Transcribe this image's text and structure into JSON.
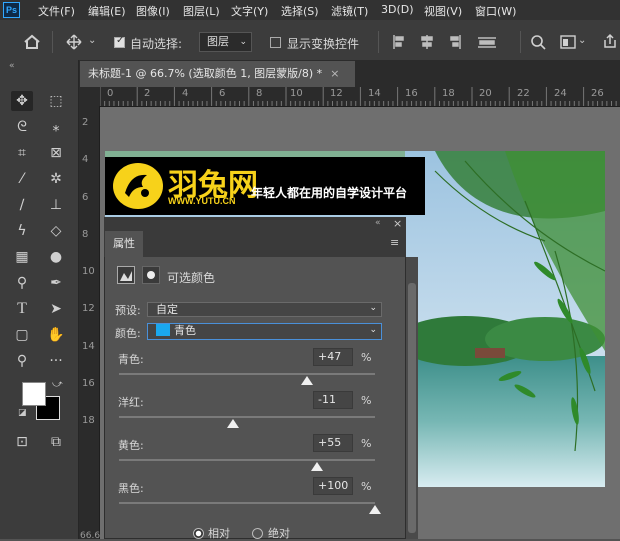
{
  "app": {
    "logo": "Ps"
  },
  "menu": [
    "文件(F)",
    "编辑(E)",
    "图像(I)",
    "图层(L)",
    "文字(Y)",
    "选择(S)",
    "滤镜(T)",
    "3D(D)",
    "视图(V)",
    "窗口(W)"
  ],
  "options": {
    "auto_select_label": "自动选择:",
    "auto_select_checked": true,
    "layer_target": "图层",
    "show_transform_label": "显示变换控件",
    "show_transform_checked": false
  },
  "document": {
    "tab_title": "未标题-1 @ 66.7% (选取颜色 1, 图层蒙版/8) *",
    "close_glyph": "×",
    "zoom_partial": "66.6"
  },
  "ruler": {
    "horizontal": [
      "0",
      "2",
      "4",
      "6",
      "8",
      "10",
      "12",
      "14",
      "16",
      "18",
      "20",
      "22",
      "24",
      "26"
    ],
    "vertical": [
      "2",
      "4",
      "6",
      "8",
      "10",
      "12",
      "14",
      "16",
      "18"
    ]
  },
  "banner": {
    "brand_cn": "羽兔网",
    "url": "WWW.YUTU.CN",
    "slogan": "年轻人都在用的自学设计平台",
    "brand_color": "#f7d21a"
  },
  "properties": {
    "panel_title": "属性",
    "adjustment_name": "可选颜色",
    "preset_label": "预设:",
    "preset_value": "自定",
    "colors_label": "颜色:",
    "colors_value": "青色",
    "colors_swatch": "#1aa8ef",
    "sliders": [
      {
        "label": "青色:",
        "value": "+47",
        "unit": "%",
        "fraction": 0.735
      },
      {
        "label": "洋红:",
        "value": "-11",
        "unit": "%",
        "fraction": 0.445
      },
      {
        "label": "黄色:",
        "value": "+55",
        "unit": "%",
        "fraction": 0.775
      },
      {
        "label": "黑色:",
        "value": "+100",
        "unit": "%",
        "fraction": 1.0
      }
    ],
    "method_options": [
      {
        "label": "相对",
        "selected": true
      },
      {
        "label": "绝对",
        "selected": false
      }
    ]
  },
  "icons": [
    "home-icon",
    "move-icon",
    "chevron-down-icon",
    "align-icons",
    "search-icon",
    "window-icon",
    "share-icon"
  ]
}
